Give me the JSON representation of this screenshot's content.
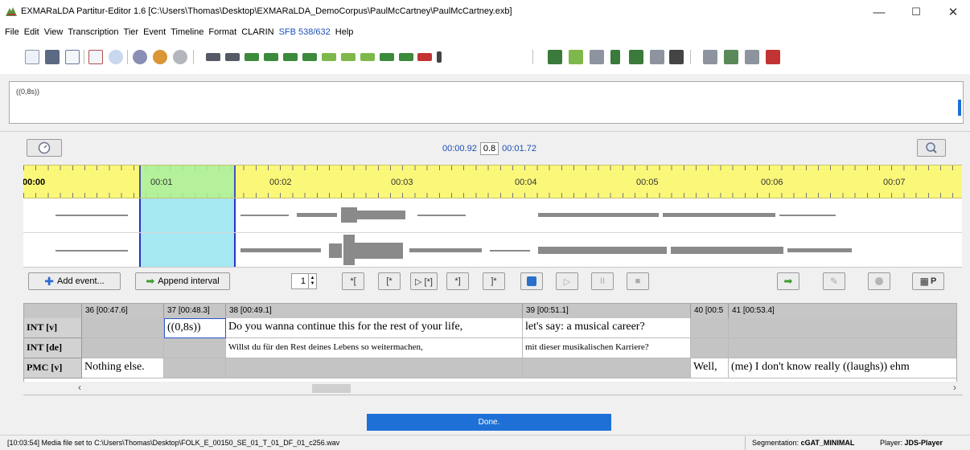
{
  "window": {
    "title": "EXMARaLDA Partitur-Editor 1.6 [C:\\Users\\Thomas\\Desktop\\EXMARaLDA_DemoCorpus\\PaulMcCartney\\PaulMcCartney.exb]",
    "minimize": "—",
    "maximize": "☐",
    "close": "✕"
  },
  "menu": [
    "File",
    "Edit",
    "View",
    "Transcription",
    "Tier",
    "Event",
    "Timeline",
    "Format",
    "CLARIN",
    "SFB 538/632",
    "Help"
  ],
  "editor": {
    "text": "((0,8s))"
  },
  "timebar": {
    "start": "00:00.92",
    "duration": "0.8",
    "end": "00:01.72"
  },
  "timeline": {
    "labels": [
      "00:00",
      "00:01",
      "00:02",
      "00:03",
      "00:04",
      "00:05",
      "00:06",
      "00:07"
    ]
  },
  "actions": {
    "add_event": "Add event...",
    "append_interval": "Append interval",
    "spinner_value": "1",
    "bracket_buttons": [
      "*[",
      "[*",
      "▷ [*]",
      "*]",
      "]*"
    ],
    "play": "▷",
    "pause": "II",
    "stop": "■",
    "p_label": "P"
  },
  "grid": {
    "columns": [
      "36 [00:47.6]",
      "37 [00:48.3]",
      "38 [00:49.1]",
      "39 [00:51.1]",
      "40 [00:5",
      "41 [00:53.4]"
    ],
    "tiers": [
      {
        "label": "INT [v]",
        "cells": [
          "",
          "((0,8s))",
          "Do you wanna continue this for the rest of your life,",
          "let's say: a musical career?",
          "",
          ""
        ]
      },
      {
        "label": "INT [de]",
        "cells": [
          "",
          "",
          "Willst du für den Rest deines Lebens so weitermachen,",
          "mit dieser musikalischen Karriere?",
          "",
          ""
        ]
      },
      {
        "label": "PMC [v]",
        "cells": [
          "Nothing else.",
          "",
          "",
          "",
          "Well,",
          "(me) I don't know really ((laughs)) ehm"
        ]
      }
    ]
  },
  "progress": {
    "label": "Done."
  },
  "status": {
    "message": "[10:03:54] Media file set to C:\\Users\\Thomas\\Desktop\\FOLK_E_00150_SE_01_T_01_DF_01_c256.wav",
    "segmentation_label": "Segmentation:",
    "segmentation_value": "cGAT_MINIMAL",
    "player_label": "Player:",
    "player_value": "JDS-Player"
  }
}
